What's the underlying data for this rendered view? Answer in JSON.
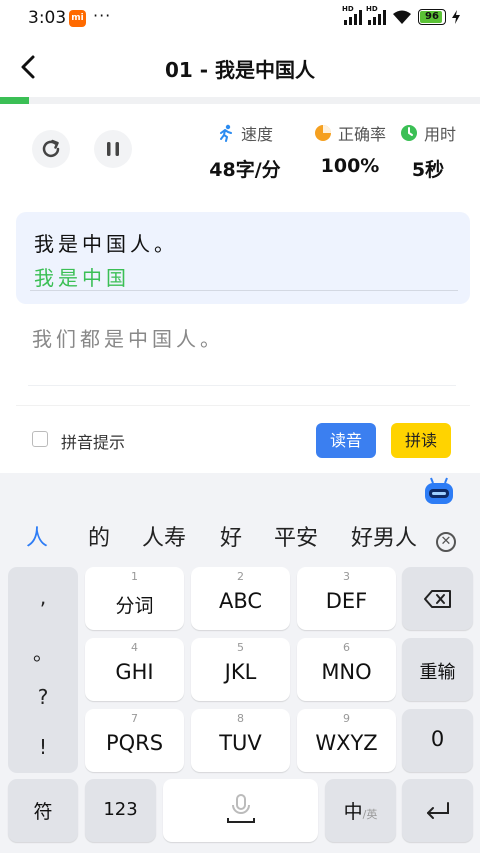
{
  "status_bar": {
    "time": "3:03",
    "mi": "mi",
    "dots": "···",
    "hd1": "HD",
    "hd2": "HD",
    "battery": "96"
  },
  "header": {
    "back_icon": "chevron-left-icon",
    "title": "01 - 我是中国人"
  },
  "progress": {
    "fraction": 0.06,
    "color": "#3bbf55"
  },
  "stats": [
    {
      "icon": "runner-icon",
      "label": "速度",
      "value": "48字/分"
    },
    {
      "icon": "pie-icon",
      "label": "正确率",
      "value": "100%"
    },
    {
      "icon": "clock-icon",
      "label": "用时",
      "value": "5秒"
    }
  ],
  "practice": {
    "line1_target": "我是中国人。",
    "line1_typed": "我是中国",
    "line2_target": "我们都是中国人。"
  },
  "options": {
    "pinyin_hint": "拼音提示",
    "read_btn": "读音",
    "spell_btn": "拼读"
  },
  "candidates": [
    "人",
    "的",
    "人寿",
    "好",
    "平安",
    "好男人"
  ],
  "keyboard": {
    "punct": [
      ",",
      "。",
      "?",
      "!"
    ],
    "row1": [
      {
        "num": "1",
        "main": "分词"
      },
      {
        "num": "2",
        "main": "ABC"
      },
      {
        "num": "3",
        "main": "DEF"
      }
    ],
    "row2": [
      {
        "num": "4",
        "main": "GHI"
      },
      {
        "num": "5",
        "main": "JKL"
      },
      {
        "num": "6",
        "main": "MNO"
      }
    ],
    "row3": [
      {
        "num": "7",
        "main": "PQRS"
      },
      {
        "num": "8",
        "main": "TUV"
      },
      {
        "num": "9",
        "main": "WXYZ"
      }
    ],
    "reinput": "重输",
    "zero": "0",
    "symbols": "符",
    "numbers": "123",
    "lang_main": "中",
    "lang_sub": "/英"
  },
  "colors": {
    "accent_blue": "#3b7ff0",
    "accent_yellow": "#ffd300",
    "typed_green": "#3bbf55"
  }
}
